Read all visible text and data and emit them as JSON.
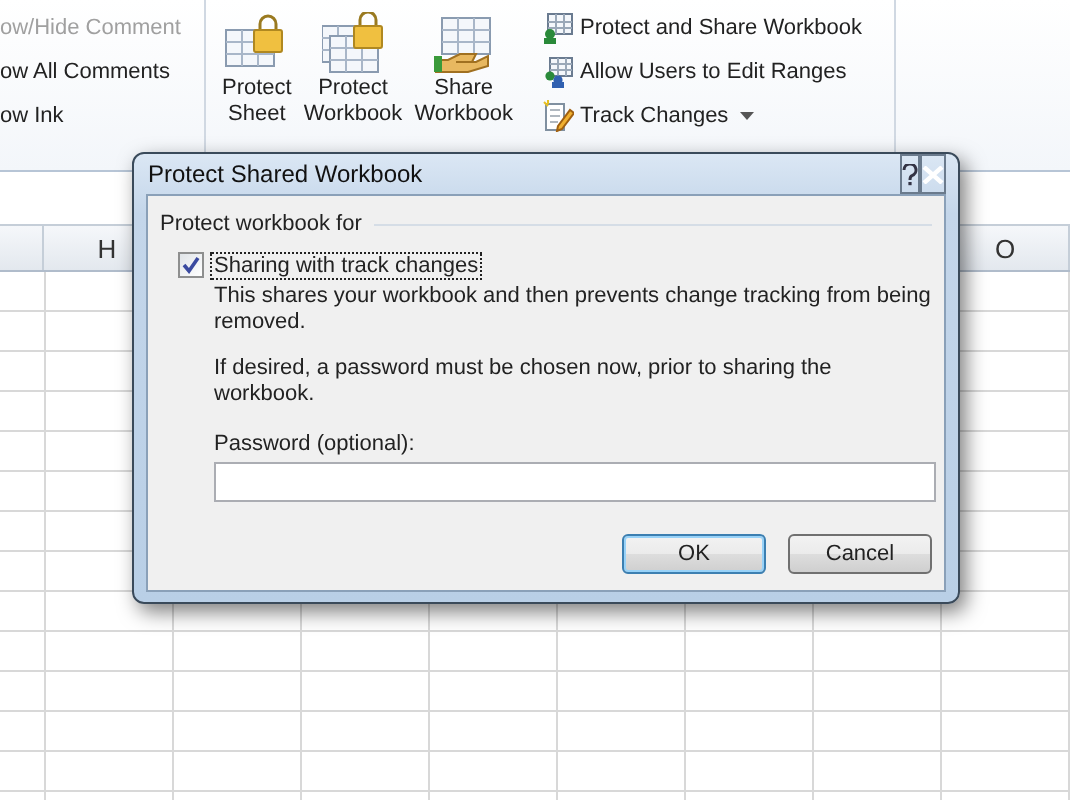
{
  "ribbon": {
    "comment_items": [
      {
        "label": "ow/Hide Comment",
        "disabled": true
      },
      {
        "label": "ow All Comments",
        "disabled": false
      },
      {
        "label": "ow Ink",
        "disabled": false
      }
    ],
    "large_buttons": [
      {
        "kind": "sheet-lock",
        "lines": [
          "Protect",
          "Sheet"
        ]
      },
      {
        "kind": "workbook-lock",
        "lines": [
          "Protect",
          "Workbook"
        ]
      },
      {
        "kind": "share",
        "lines": [
          "Share",
          "Workbook"
        ]
      }
    ],
    "small_buttons": [
      {
        "kind": "protect-share",
        "label": "Protect and Share Workbook",
        "dropdown": false
      },
      {
        "kind": "users",
        "label": "Allow Users to Edit Ranges",
        "dropdown": false
      },
      {
        "kind": "track",
        "label": "Track Changes",
        "dropdown": true
      }
    ]
  },
  "sheet": {
    "column_headers": [
      {
        "label": "H"
      },
      {
        "label": "O"
      }
    ]
  },
  "dialog": {
    "title": "Protect Shared Workbook",
    "group_label": "Protect workbook for",
    "checkbox": {
      "label": "Sharing with track changes",
      "checked": true,
      "focused": true
    },
    "descriptions": [
      "This shares your workbook and then prevents change tracking from being removed.",
      "If desired, a password must be chosen now, prior to sharing the workbook."
    ],
    "password": {
      "label": "Password (optional):"
    },
    "buttons": [
      {
        "label": "OK",
        "default": true
      },
      {
        "label": "Cancel",
        "default": false
      }
    ]
  }
}
